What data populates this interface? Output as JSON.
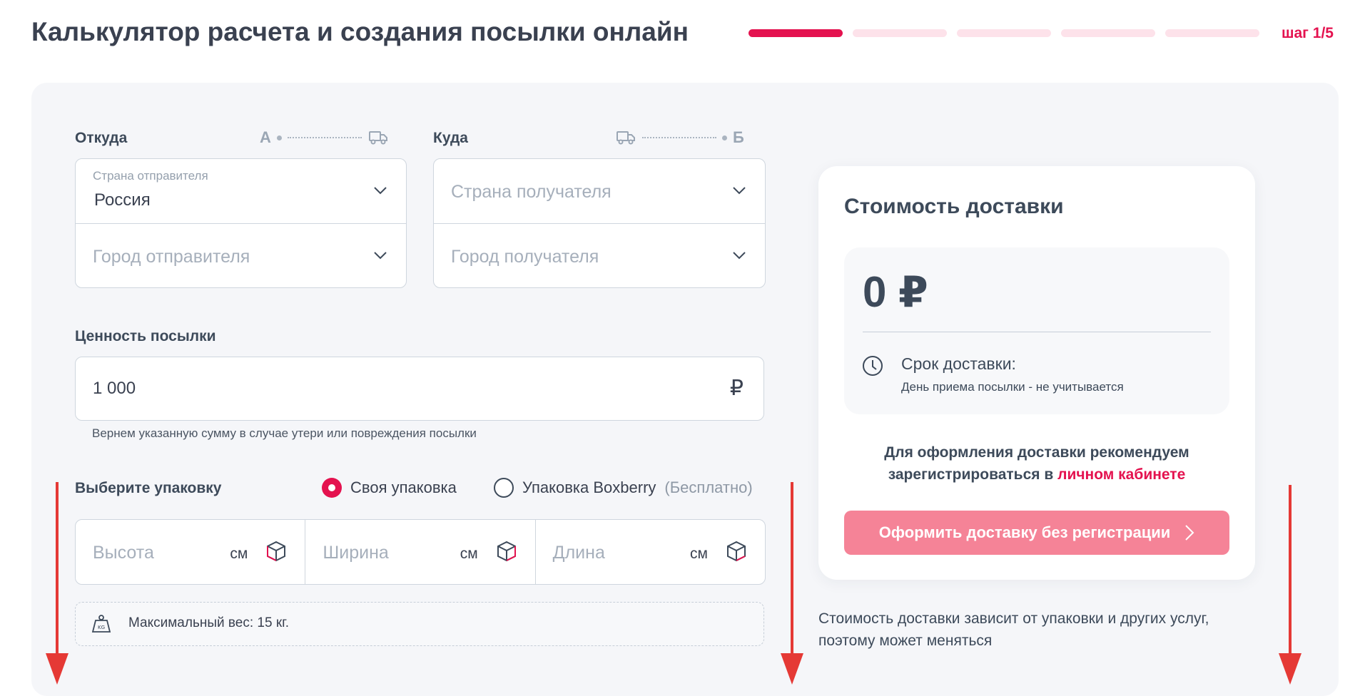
{
  "header": {
    "title": "Калькулятор расчета и создания посылки онлайн",
    "step_label": "шаг 1/5",
    "steps": {
      "total": 5,
      "current": 1
    }
  },
  "from": {
    "label": "Откуда",
    "point_letter": "А",
    "country_caption": "Страна отправителя",
    "country_value": "Россия",
    "city_placeholder": "Город отправителя"
  },
  "to": {
    "label": "Куда",
    "point_letter": "Б",
    "country_placeholder": "Страна получателя",
    "city_placeholder": "Город получателя"
  },
  "value": {
    "label": "Ценность посылки",
    "amount": "1 000",
    "currency": "₽",
    "hint": "Вернем указанную сумму в случае утери или повреждения посылки"
  },
  "packaging": {
    "label": "Выберите упаковку",
    "options": [
      {
        "label": "Своя упаковка",
        "selected": true
      },
      {
        "label": "Упаковка Boxberry",
        "note": "(Бесплатно)",
        "selected": false
      }
    ],
    "dimensions": [
      {
        "placeholder": "Высота",
        "unit": "см"
      },
      {
        "placeholder": "Ширина",
        "unit": "см"
      },
      {
        "placeholder": "Длина",
        "unit": "см"
      }
    ],
    "max_weight": "Максимальный вес: 15 кг.",
    "weight_icon_text": "KG"
  },
  "cost": {
    "title": "Стоимость доставки",
    "price": "0 ₽",
    "term_label": "Срок доставки:",
    "term_note": "День приема посылки - не учитывается",
    "reg_text": "Для оформления доставки рекомендуем зарегистрироваться в",
    "reg_link": "личном кабинете",
    "button_label": "Оформить доставку без регистрации",
    "note": "Стоимость доставки зависит от упаковки и других услуг, поэтому может меняться"
  },
  "colors": {
    "accent": "#e4124f",
    "accent_light": "#fde2ea",
    "button": "#f58397",
    "arrow": "#e53935"
  },
  "icons": [
    "truck-icon",
    "chevron-down-icon",
    "ruble-icon",
    "cube-icon",
    "weight-icon",
    "clock-icon",
    "chevron-right-icon",
    "arrow-down-icon"
  ]
}
